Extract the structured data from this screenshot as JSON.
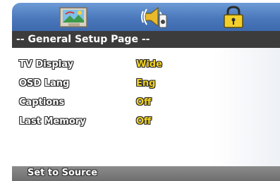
{
  "tabs": [
    {
      "icon": "general-setup-picture-icon"
    },
    {
      "icon": "audio-speaker-icon"
    },
    {
      "icon": "padlock-icon"
    }
  ],
  "page_title": "-- General Setup Page --",
  "settings": [
    {
      "label": "TV Display",
      "value": "Wide"
    },
    {
      "label": "OSD Lang",
      "value": "Eng"
    },
    {
      "label": "Captions",
      "value": "Off"
    },
    {
      "label": "Last Memory",
      "value": "Off"
    }
  ],
  "status_text": "Set to Source",
  "colors": {
    "tab_bar": "#4a78bb",
    "title_bar": "#3c3c3c",
    "value_text": "#f2d21f",
    "status_bar": "#7a7a7a"
  }
}
